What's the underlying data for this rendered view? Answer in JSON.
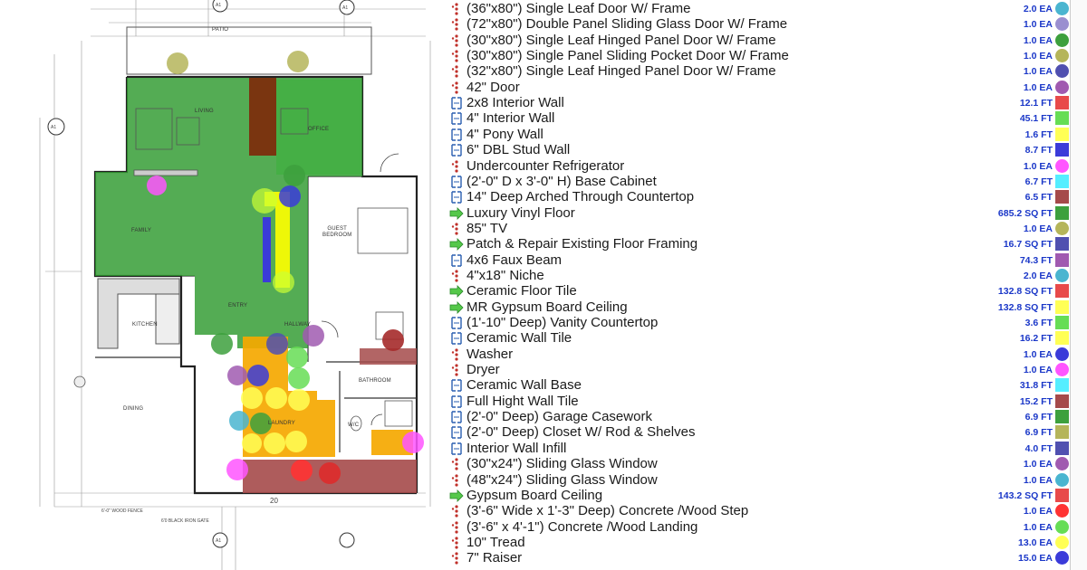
{
  "plan": {
    "rooms": {
      "patio": "PATIO",
      "living": "LIVING",
      "office": "OFFICE",
      "family": "FAMILY",
      "guest_bedroom": "GUEST\nBEDROOM",
      "kitchen": "KITCHEN",
      "entry": "ENTRY",
      "hallway": "HALLWAY",
      "dining": "DINING",
      "bathroom": "BATHROOM",
      "laundry": "LAUNDRY",
      "wic": "W/C"
    },
    "notes": {
      "fence_a": "6'-0\" WOOD FENCE",
      "fence_b": "6'0 BLACK IRON GATE",
      "dim_20": "20"
    },
    "section_tags": [
      "A1",
      "A1",
      "A1",
      "A1"
    ],
    "colors": {
      "floor_green": "#2e9a2e",
      "beam_brown": "#7a3510",
      "countertop_red": "#a52a2a",
      "tile_orange": "#f5a800",
      "highlight_yellow": "#ffff00",
      "wall_blue": "#3b3bd9"
    }
  },
  "takeoff": {
    "items": [
      {
        "label": "(36\"x80\") Single Leaf  Door W/ Frame",
        "qty": "2.0 EA",
        "icon": "count-dots-icon",
        "color": "#4ab5d0",
        "shape": "circle"
      },
      {
        "label": "(72\"x80\") Double Panel Sliding Glass Door W/ Frame",
        "qty": "1.0 EA",
        "icon": "count-dots-icon",
        "color": "#9a8fd0",
        "shape": "circle"
      },
      {
        "label": "(30\"x80\") Single Leaf Hinged Panel Door W/ Frame",
        "qty": "1.0 EA",
        "icon": "count-dots-icon",
        "color": "#3da03d",
        "shape": "circle"
      },
      {
        "label": "(30\"x80\") Single Panel Sliding Pocket Door W/ Frame",
        "qty": "1.0 EA",
        "icon": "count-dots-icon",
        "color": "#b5b55a",
        "shape": "circle"
      },
      {
        "label": "(32\"x80\") Single Leaf Hinged Panel Door W/ Frame",
        "qty": "1.0 EA",
        "icon": "count-dots-icon",
        "color": "#5050b0",
        "shape": "circle"
      },
      {
        "label": "42\" Door",
        "qty": "1.0 EA",
        "icon": "count-dots-icon",
        "color": "#a05ab0",
        "shape": "circle"
      },
      {
        "label": "2x8 Interior Wall",
        "qty": "12.1 FT",
        "icon": "linear-measure-icon",
        "color": "#e84a4a",
        "shape": "square"
      },
      {
        "label": "4\" Interior Wall",
        "qty": "45.1 FT",
        "icon": "linear-measure-icon",
        "color": "#66dd55",
        "shape": "square"
      },
      {
        "label": "4\" Pony Wall",
        "qty": "1.6 FT",
        "icon": "linear-measure-icon",
        "color": "#ffff55",
        "shape": "square"
      },
      {
        "label": "6\" DBL Stud Wall",
        "qty": "8.7 FT",
        "icon": "linear-measure-icon",
        "color": "#3b3bd9",
        "shape": "square"
      },
      {
        "label": "Undercounter Refrigerator",
        "qty": "1.0 EA",
        "icon": "count-dots-icon",
        "color": "#ff55ff",
        "shape": "circle"
      },
      {
        "label": "(2'-0\" D x 3'-0\" H) Base Cabinet",
        "qty": "6.7 FT",
        "icon": "linear-measure-icon",
        "color": "#55eeff",
        "shape": "square"
      },
      {
        "label": "14\" Deep Arched Through Countertop",
        "qty": "6.5 FT",
        "icon": "linear-measure-icon",
        "color": "#a54a4a",
        "shape": "square"
      },
      {
        "label": "Luxury  Vinyl Floor",
        "qty": "685.2 SQ FT",
        "icon": "area-icon",
        "color": "#3da03d",
        "shape": "square"
      },
      {
        "label": "85\" TV",
        "qty": "1.0 EA",
        "icon": "count-dots-icon",
        "color": "#b5b55a",
        "shape": "circle"
      },
      {
        "label": "Patch & Repair Existing Floor Framing",
        "qty": "16.7 SQ FT",
        "icon": "area-icon",
        "color": "#5050b0",
        "shape": "square"
      },
      {
        "label": "4x6 Faux Beam",
        "qty": "74.3 FT",
        "icon": "linear-measure-icon",
        "color": "#a05ab0",
        "shape": "square"
      },
      {
        "label": "4\"x18\" Niche",
        "qty": "2.0 EA",
        "icon": "count-dots-icon",
        "color": "#4ab5d0",
        "shape": "circle"
      },
      {
        "label": "Ceramic Floor Tile",
        "qty": "132.8 SQ FT",
        "icon": "area-icon",
        "color": "#e84a4a",
        "shape": "square"
      },
      {
        "label": "MR Gypsum Board Ceiling",
        "qty": "132.8 SQ FT",
        "icon": "area-icon",
        "color": "#ffff55",
        "shape": "square"
      },
      {
        "label": "(1'-10\" Deep) Vanity Countertop",
        "qty": "3.6 FT",
        "icon": "linear-measure-icon",
        "color": "#66dd55",
        "shape": "square"
      },
      {
        "label": "Ceramic Wall Tile",
        "qty": "16.2 FT",
        "icon": "linear-measure-icon",
        "color": "#ffff55",
        "shape": "square"
      },
      {
        "label": "Washer",
        "qty": "1.0 EA",
        "icon": "count-dots-icon",
        "color": "#3b3bd9",
        "shape": "circle"
      },
      {
        "label": "Dryer",
        "qty": "1.0 EA",
        "icon": "count-dots-icon",
        "color": "#ff55ff",
        "shape": "circle"
      },
      {
        "label": "Ceramic Wall Base",
        "qty": "31.8 FT",
        "icon": "linear-measure-icon",
        "color": "#55eeff",
        "shape": "square"
      },
      {
        "label": "Full Hight Wall Tile",
        "qty": "15.2 FT",
        "icon": "linear-measure-icon",
        "color": "#a54a4a",
        "shape": "square"
      },
      {
        "label": "(2'-0\" Deep) Garage Casework",
        "qty": "6.9 FT",
        "icon": "linear-measure-icon",
        "color": "#3da03d",
        "shape": "square"
      },
      {
        "label": "(2'-0\" Deep) Closet W/ Rod & Shelves",
        "qty": "6.9 FT",
        "icon": "linear-measure-icon",
        "color": "#b5b55a",
        "shape": "square"
      },
      {
        "label": "Interior Wall Infill",
        "qty": "4.0 FT",
        "icon": "linear-measure-icon",
        "color": "#5050b0",
        "shape": "square"
      },
      {
        "label": "(30\"x24\") Sliding Glass Window",
        "qty": "1.0 EA",
        "icon": "count-dots-icon",
        "color": "#a05ab0",
        "shape": "circle"
      },
      {
        "label": "(48\"x24\") Sliding Glass Window",
        "qty": "1.0 EA",
        "icon": "count-dots-icon",
        "color": "#4ab5d0",
        "shape": "circle"
      },
      {
        "label": "Gypsum Board Ceiling",
        "qty": "143.2 SQ FT",
        "icon": "area-icon",
        "color": "#e84a4a",
        "shape": "square"
      },
      {
        "label": "(3'-6\" Wide x 1'-3\" Deep) Concrete /Wood Step",
        "qty": "1.0 EA",
        "icon": "count-dots-icon",
        "color": "#ff3333",
        "shape": "circle"
      },
      {
        "label": "(3'-6\" x 4'-1\") Concrete /Wood Landing",
        "qty": "1.0 EA",
        "icon": "count-dots-icon",
        "color": "#66dd55",
        "shape": "circle"
      },
      {
        "label": "10\" Tread",
        "qty": "13.0 EA",
        "icon": "count-dots-icon",
        "color": "#ffff55",
        "shape": "circle"
      },
      {
        "label": "7\" Raiser",
        "qty": "15.0 EA",
        "icon": "count-dots-icon",
        "color": "#3b3bd9",
        "shape": "circle"
      }
    ]
  }
}
